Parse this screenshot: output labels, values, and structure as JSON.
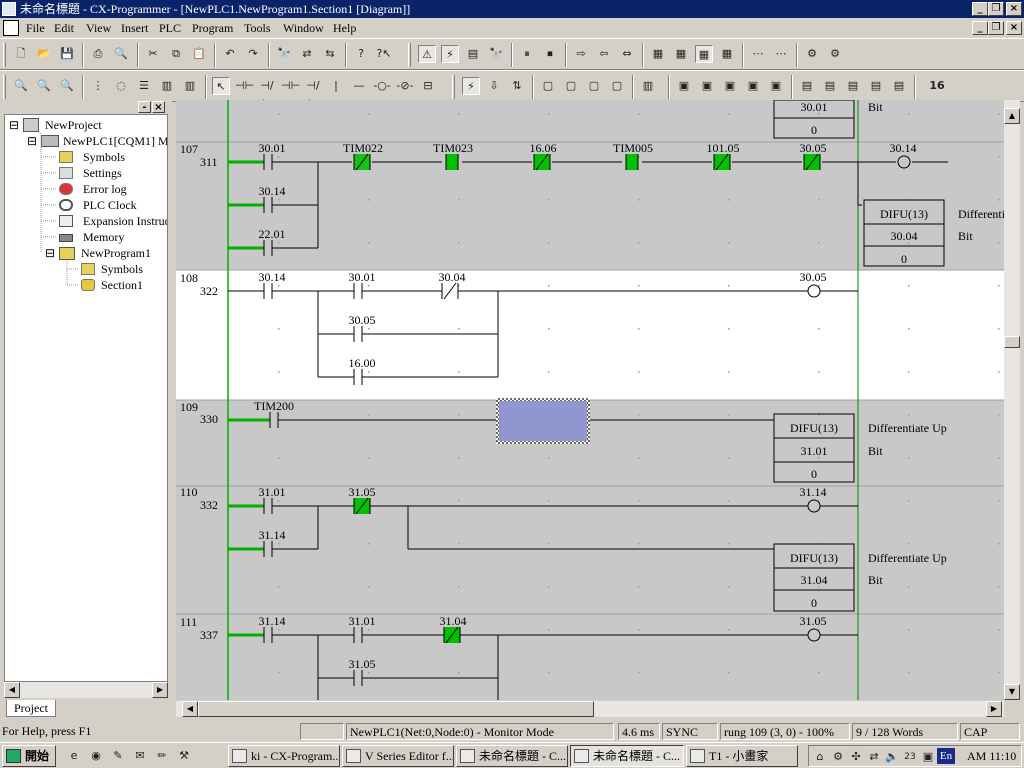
{
  "window": {
    "title": "未命名標題 - CX-Programmer - [NewPLC1.NewProgram1.Section1 [Diagram]]"
  },
  "menu": [
    "File",
    "Edit",
    "View",
    "Insert",
    "PLC",
    "Program",
    "Tools",
    "Window",
    "Help"
  ],
  "tree": {
    "items": [
      {
        "label": "NewProject",
        "icon": "project-icon"
      },
      {
        "label": "NewPLC1[CQM1] M",
        "icon": "plc-icon"
      },
      {
        "label": "Symbols",
        "icon": "symbols-icon"
      },
      {
        "label": "Settings",
        "icon": "settings-icon"
      },
      {
        "label": "Error log",
        "icon": "error-log-icon"
      },
      {
        "label": "PLC Clock",
        "icon": "clock-icon"
      },
      {
        "label": "Expansion Instruc",
        "icon": "expansion-icon"
      },
      {
        "label": "Memory",
        "icon": "memory-icon"
      },
      {
        "label": "NewProgram1",
        "icon": "program-icon"
      },
      {
        "label": "Symbols",
        "icon": "symbols-icon"
      },
      {
        "label": "Section1",
        "icon": "section-icon"
      }
    ],
    "tab": "Project"
  },
  "rungs": [
    {
      "top_box": {
        "label": "30.01",
        "value": "0",
        "comment": "Bit"
      }
    },
    {
      "number": "107",
      "step": "311",
      "contacts": [
        "30.01",
        "TIM022",
        "TIM023",
        "16.06",
        "TIM005",
        "101.05",
        "30.05",
        "30.14",
        "22.01"
      ],
      "coil": "30.14",
      "box": {
        "title": "DIFU(13)",
        "operand": "30.04",
        "value": "0",
        "comment": "Differenti",
        "comment2": "Bit"
      }
    },
    {
      "number": "108",
      "step": "322",
      "contacts": [
        "30.14",
        "30.01",
        "30.04",
        "30.05",
        "16.00"
      ],
      "coil": "30.05"
    },
    {
      "number": "109",
      "step": "330",
      "contacts": [
        "TIM200"
      ],
      "box": {
        "title": "DIFU(13)",
        "operand": "31.01",
        "value": "0",
        "comment": "Differentiate Up",
        "comment2": "Bit"
      }
    },
    {
      "number": "110",
      "step": "332",
      "contacts": [
        "31.01",
        "31.05",
        "31.14"
      ],
      "coil": "31.14",
      "box": {
        "title": "DIFU(13)",
        "operand": "31.04",
        "value": "0",
        "comment": "Differentiate Up",
        "comment2": "Bit"
      }
    },
    {
      "number": "111",
      "step": "337",
      "contacts": [
        "31.14",
        "31.01",
        "31.04",
        "31.05"
      ],
      "coil": "31.05"
    }
  ],
  "status": {
    "help": "For Help, press F1",
    "mode": "NewPLC1(Net:0,Node:0) - Monitor Mode",
    "scan": "4.6 ms",
    "sync": "SYNC",
    "position": "rung 109 (3, 0)  - 100%",
    "words": "9 / 128 Words",
    "caps": "CAP"
  },
  "taskbar": {
    "start": "開始",
    "buttons": [
      "ki - CX-Program...",
      "V Series Editor f...",
      "未命名標題 - C...",
      "未命名標題 - C...",
      "T1 - 小畫家"
    ],
    "lang": "En",
    "date": "23",
    "clock": "AM 11:10"
  },
  "colors": {
    "rail": "#00b000",
    "selection": "#9096d0",
    "titlebar": "#0a246a",
    "active_rung": "#ffffff",
    "rung_bg": "#c8c8c8"
  }
}
